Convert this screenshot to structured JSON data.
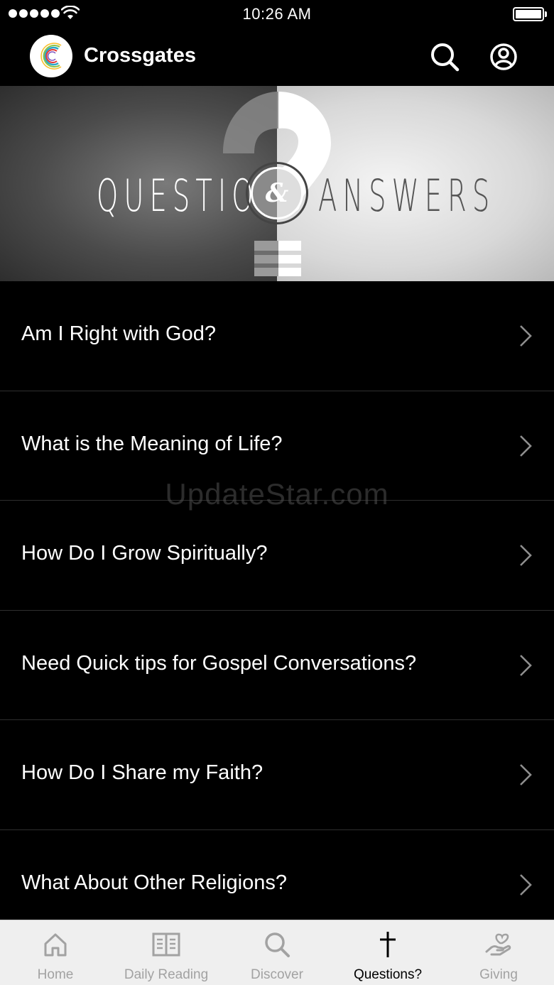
{
  "status_bar": {
    "time": "10:26 AM"
  },
  "header": {
    "title": "Crossgates"
  },
  "banner": {
    "left_word": "QUESTIONS",
    "ampersand": "&",
    "right_word": "ANSWERS"
  },
  "questions": [
    {
      "label": "Am I Right with God?"
    },
    {
      "label": "What is the Meaning of Life?"
    },
    {
      "label": "How Do I Grow Spiritually?"
    },
    {
      "label": "Need Quick tips for Gospel Conversations?"
    },
    {
      "label": "How Do I Share my Faith?"
    },
    {
      "label": "What About Other Religions?"
    }
  ],
  "watermark": "UpdateStar.com",
  "tabs": [
    {
      "label": "Home",
      "icon": "home-icon"
    },
    {
      "label": "Daily Reading",
      "icon": "book-icon"
    },
    {
      "label": "Discover",
      "icon": "search-icon"
    },
    {
      "label": "Questions?",
      "icon": "cross-icon",
      "active": true
    },
    {
      "label": "Giving",
      "icon": "heart-hand-icon"
    }
  ],
  "colors": {
    "background": "#000000",
    "tab_bar": "#efefef",
    "tab_inactive": "#a2a2a2",
    "tab_active": "#000000",
    "divider": "#2e2e2e"
  }
}
